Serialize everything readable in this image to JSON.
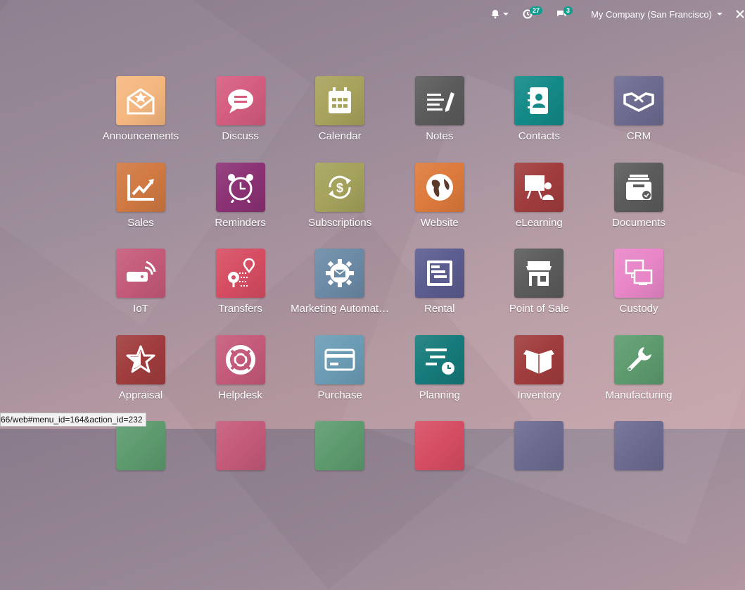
{
  "systray": {
    "activity_badge": "27",
    "messages_badge": "3",
    "company": "My Company (San Francisco)"
  },
  "apps": [
    {
      "label": "Announcements",
      "icon": "envelope-star-icon",
      "color": "#f5b77f"
    },
    {
      "label": "Discuss",
      "icon": "chat-bubble-icon",
      "color": "#d45d7f"
    },
    {
      "label": "Calendar",
      "icon": "calendar-icon",
      "color": "#a7a25c"
    },
    {
      "label": "Notes",
      "icon": "note-pencil-icon",
      "color": "#5b5b5b"
    },
    {
      "label": "Contacts",
      "icon": "address-book-icon",
      "color": "#138a87"
    },
    {
      "label": "CRM",
      "icon": "handshake-icon",
      "color": "#6c6b90"
    },
    {
      "label": "Sales",
      "icon": "trend-chart-icon",
      "color": "#d07942"
    },
    {
      "label": "Reminders",
      "icon": "alarm-clock-icon",
      "color": "#8b3174"
    },
    {
      "label": "Subscriptions",
      "icon": "recurring-dollar-icon",
      "color": "#a4a25b"
    },
    {
      "label": "Website",
      "icon": "globe-icon",
      "color": "#dd7a3c"
    },
    {
      "label": "eLearning",
      "icon": "presentation-icon",
      "color": "#a03c3d"
    },
    {
      "label": "Documents",
      "icon": "inbox-tray-icon",
      "color": "#5b5b5b"
    },
    {
      "label": "IoT",
      "icon": "wireless-device-icon",
      "color": "#c45a7a"
    },
    {
      "label": "Transfers",
      "icon": "map-route-icon",
      "color": "#d64d62"
    },
    {
      "label": "Marketing Automat…",
      "icon": "gear-envelope-icon",
      "color": "#6b8aa5"
    },
    {
      "label": "Rental",
      "icon": "schedule-board-icon",
      "color": "#5b5c8f"
    },
    {
      "label": "Point of Sale",
      "icon": "shop-icon",
      "color": "#5b5b5b"
    },
    {
      "label": "Custody",
      "icon": "monitors-icon",
      "color": "#e886c8"
    },
    {
      "label": "Appraisal",
      "icon": "star-icon",
      "color": "#a03c3d"
    },
    {
      "label": "Helpdesk",
      "icon": "life-ring-icon",
      "color": "#c45a7a"
    },
    {
      "label": "Purchase",
      "icon": "credit-card-icon",
      "color": "#6b9cb5"
    },
    {
      "label": "Planning",
      "icon": "planning-clock-icon",
      "color": "#167a7a"
    },
    {
      "label": "Inventory",
      "icon": "open-box-icon",
      "color": "#a03c3d"
    },
    {
      "label": "Manufacturing",
      "icon": "wrench-icon",
      "color": "#5d9b6e"
    }
  ],
  "status_url": "66/web#menu_id=164&action_id=232"
}
